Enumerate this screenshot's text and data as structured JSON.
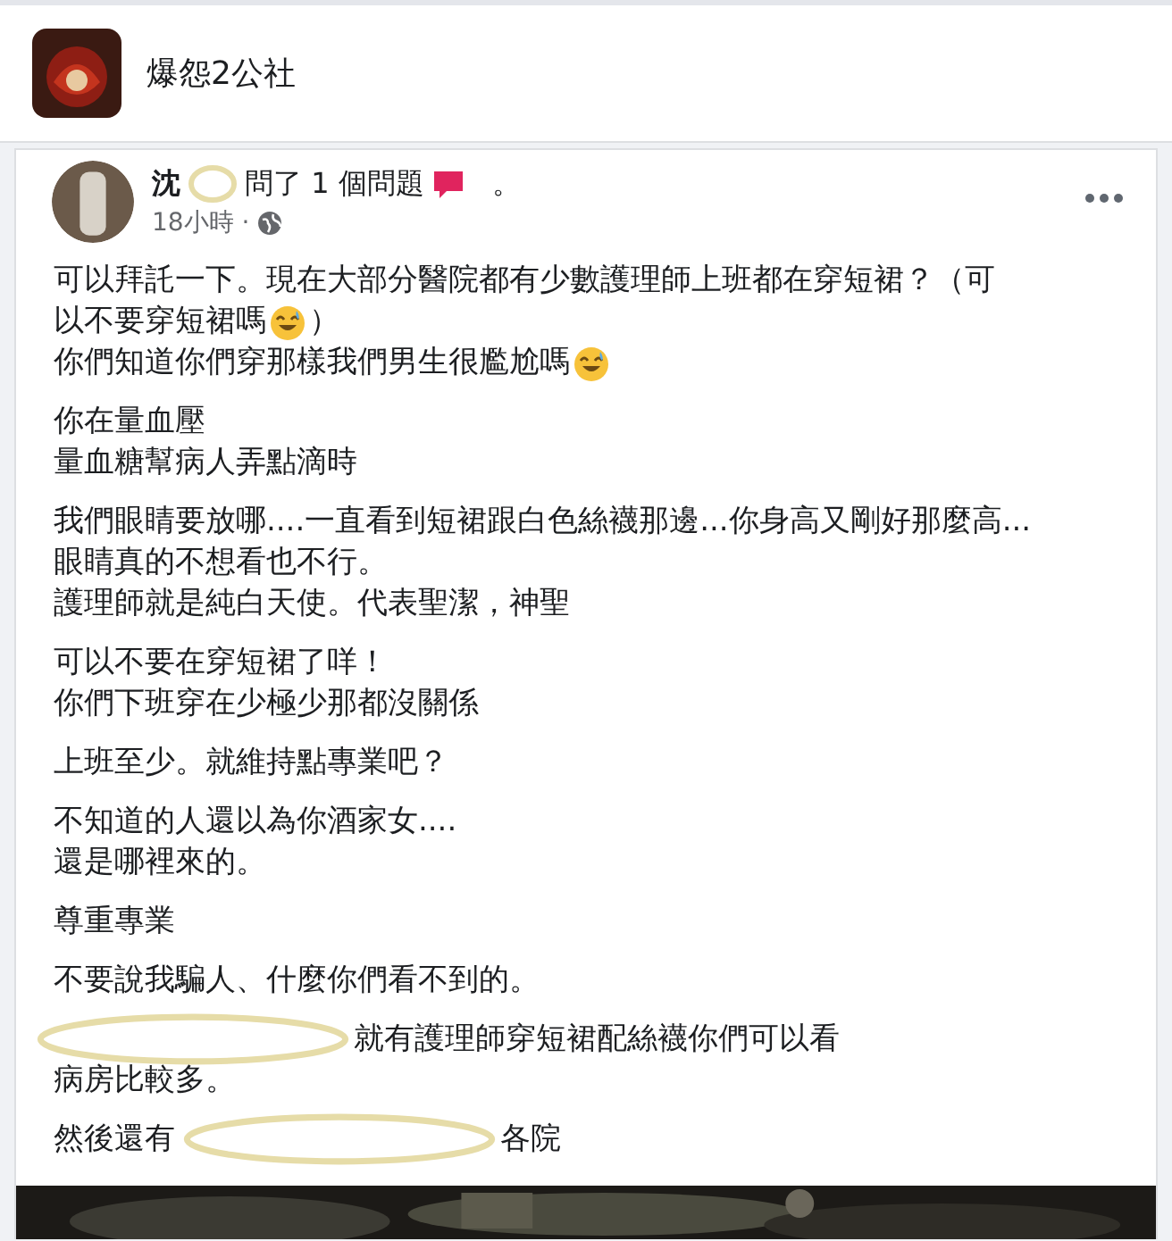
{
  "group": {
    "name": "爆怨2公社"
  },
  "post": {
    "author": "沈",
    "action": "問了 1 個問題",
    "suffix": "。",
    "time": "18小時 ·",
    "paragraphs": [
      [
        [
          {
            "kind": "text",
            "text": "可以拜託一下。現在大部分醫院都有少數護理師上班都在穿短裙？（可"
          }
        ],
        [
          {
            "kind": "text",
            "text": "以不要穿短裙嗎"
          },
          {
            "kind": "emoji"
          },
          {
            "kind": "text",
            "text": "）"
          }
        ],
        [
          {
            "kind": "text",
            "text": "你們知道你們穿那樣我們男生很尷尬嗎"
          },
          {
            "kind": "emoji"
          }
        ]
      ],
      [
        [
          {
            "kind": "text",
            "text": "你在量血壓"
          }
        ],
        [
          {
            "kind": "text",
            "text": "量血糖幫病人弄點滴時"
          }
        ]
      ],
      [
        [
          {
            "kind": "text",
            "text": "我們眼睛要放哪....一直看到短裙跟白色絲襪那邊...你身高又剛好那麼高..."
          }
        ],
        [
          {
            "kind": "text",
            "text": "眼睛真的不想看也不行。"
          }
        ],
        [
          {
            "kind": "text",
            "text": "護理師就是純白天使。代表聖潔，神聖"
          }
        ]
      ],
      [
        [
          {
            "kind": "text",
            "text": "可以不要在穿短裙了咩！"
          }
        ],
        [
          {
            "kind": "text",
            "text": "你們下班穿在少極少那都沒關係"
          }
        ]
      ],
      [
        [
          {
            "kind": "text",
            "text": "上班至少。就維持點專業吧？"
          }
        ]
      ],
      [
        [
          {
            "kind": "text",
            "text": "不知道的人還以為你酒家女...."
          }
        ],
        [
          {
            "kind": "text",
            "text": "還是哪裡來的。"
          }
        ]
      ],
      [
        [
          {
            "kind": "text",
            "text": "尊重專業"
          }
        ]
      ],
      [
        [
          {
            "kind": "text",
            "text": "不要說我騙人、什麼你們看不到的。"
          }
        ]
      ],
      [
        [
          {
            "kind": "redaction"
          },
          {
            "kind": "text",
            "text": "就有護理師穿短裙配絲襪你們可以看"
          }
        ],
        [
          {
            "kind": "text",
            "text": "病房比較多。"
          }
        ]
      ],
      [
        [
          {
            "kind": "text",
            "text": "然後還有"
          },
          {
            "kind": "redaction"
          },
          {
            "kind": "text",
            "text": "各院"
          }
        ]
      ]
    ]
  }
}
